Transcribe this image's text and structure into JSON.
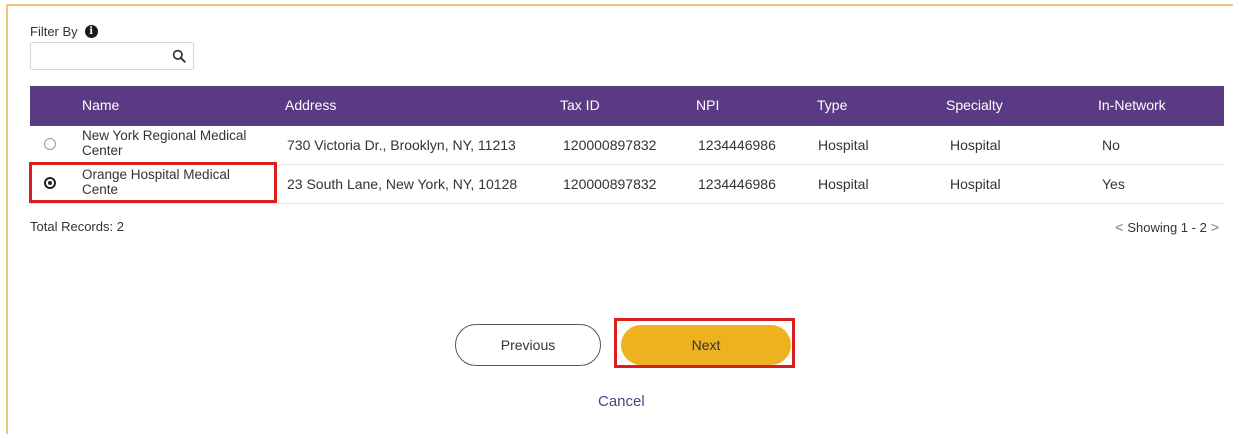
{
  "filter": {
    "label": "Filter By",
    "info_glyph": "i",
    "value": "",
    "placeholder": ""
  },
  "table": {
    "headers": [
      "Name",
      "Address",
      "Tax ID",
      "NPI",
      "Type",
      "Specialty",
      "In-Network"
    ],
    "rows": [
      {
        "selected": false,
        "name": "New York Regional Medical Center",
        "address": "730 Victoria Dr., Brooklyn, NY, 11213",
        "tax_id": "120000897832",
        "npi": "1234446986",
        "type": "Hospital",
        "specialty": "Hospital",
        "in_network": "No"
      },
      {
        "selected": true,
        "name": "Orange Hospital Medical Cente",
        "address": "23 South Lane, New York, NY, 10128",
        "tax_id": "120000897832",
        "npi": "1234446986",
        "type": "Hospital",
        "specialty": "Hospital",
        "in_network": "Yes"
      }
    ]
  },
  "footer": {
    "total_records": "Total Records: 2",
    "showing": "Showing 1 - 2",
    "prev_chevron": "<",
    "next_chevron": ">"
  },
  "actions": {
    "previous_label": "Previous",
    "next_label": "Next",
    "cancel_label": "Cancel"
  },
  "colors": {
    "header_bg": "#5a3a82",
    "next_button": "#efb21f",
    "highlight": "#d81f1f",
    "frame_border": "#f3c27b"
  },
  "icons": {
    "filter_info": "info-icon",
    "filter_search": "search-icon",
    "pager_prev": "chevron-left-icon",
    "pager_next": "chevron-right-icon"
  }
}
